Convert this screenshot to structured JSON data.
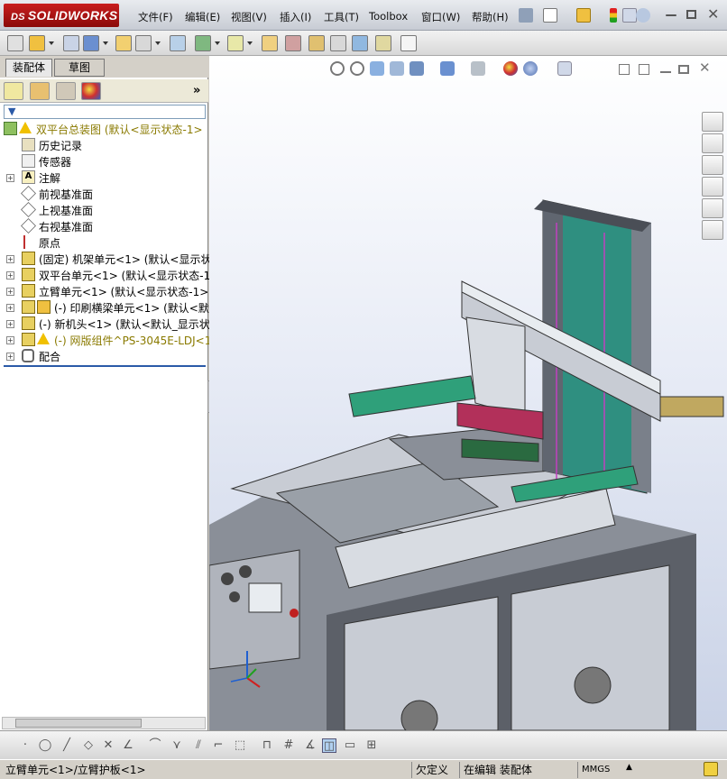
{
  "app": {
    "name": "SOLIDWORKS",
    "logo_prefix": "DS"
  },
  "menu": [
    {
      "label": "文件(F)"
    },
    {
      "label": "编辑(E)"
    },
    {
      "label": "视图(V)"
    },
    {
      "label": "插入(I)"
    },
    {
      "label": "工具(T)"
    },
    {
      "label": "Toolbox"
    },
    {
      "label": "窗口(W)"
    },
    {
      "label": "帮助(H)"
    }
  ],
  "tabs": {
    "assembly": "装配体",
    "sketch": "草图"
  },
  "tree": {
    "root": "双平台总装图  (默认<显示状态-1>",
    "items": [
      {
        "label": "历史记录",
        "icon": "history-icon"
      },
      {
        "label": "传感器",
        "icon": "sensor-icon"
      },
      {
        "label": "注解",
        "icon": "annotation-icon"
      },
      {
        "label": "前视基准面",
        "icon": "plane-icon"
      },
      {
        "label": "上视基准面",
        "icon": "plane-icon"
      },
      {
        "label": "右视基准面",
        "icon": "plane-icon"
      },
      {
        "label": "原点",
        "icon": "origin-icon"
      },
      {
        "label": "(固定) 机架单元<1> (默认<显示状",
        "icon": "component-icon"
      },
      {
        "label": "双平台单元<1> (默认<显示状态-1>",
        "icon": "component-icon"
      },
      {
        "label": "立臂单元<1> (默认<显示状态-1>)",
        "icon": "component-icon"
      },
      {
        "label": "(-) 印刷横梁单元<1> (默认<默",
        "icon": "component-icon"
      },
      {
        "label": "(-) 新机头<1> (默认<默认_显示状",
        "icon": "component-icon"
      },
      {
        "label": "(-) 网版组件^PS-3045E-LDJ<1>",
        "icon": "warning-icon"
      },
      {
        "label": "配合",
        "icon": "mates-icon"
      }
    ]
  },
  "status": {
    "selection": "立臂单元<1>/立臂护板<1>",
    "definition": "欠定义",
    "mode": "在编辑 装配体",
    "units": "MMGS"
  },
  "colors": {
    "brand": "#b81818",
    "accent": "#2a5aa8",
    "machine_green": "#2fa07a",
    "machine_magenta": "#b2305a"
  }
}
